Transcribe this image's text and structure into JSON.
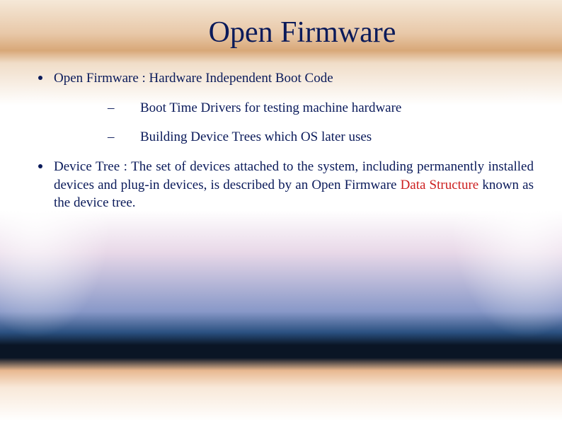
{
  "slide": {
    "title": "Open Firmware",
    "bullet1": {
      "text": "Open Firmware : Hardware Independent Boot Code",
      "sub1": "Boot Time Drivers for testing machine hardware",
      "sub2": "Building Device Trees which OS later uses"
    },
    "bullet2": {
      "prefix": "Device Tree : The set of devices attached to the system, including permanently installed devices and plug-in devices, is described by an Open Firmware ",
      "highlight": "Data Structure",
      "suffix": " known as the device tree."
    }
  }
}
